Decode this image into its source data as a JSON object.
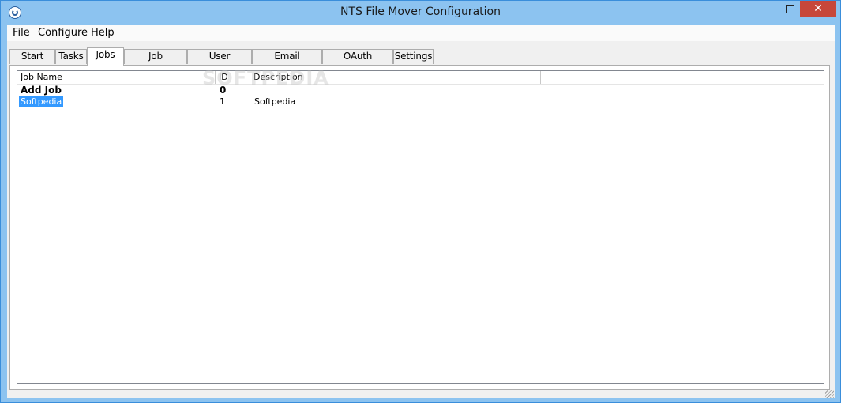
{
  "window": {
    "title": "NTS File Mover Configuration",
    "minimize_label": "–",
    "close_label": "✕"
  },
  "menu": [
    "File",
    "Configure",
    "Help"
  ],
  "tabs": [
    {
      "label": "Start Here",
      "active": false
    },
    {
      "label": "Tasks",
      "active": false
    },
    {
      "label": "Jobs",
      "active": true
    },
    {
      "label": "Job Schedules",
      "active": false
    },
    {
      "label": "User Accounts",
      "active": false
    },
    {
      "label": "Email Addresses",
      "active": false
    },
    {
      "label": "OAuth Accounts",
      "active": false
    },
    {
      "label": "Settings",
      "active": false
    }
  ],
  "jobs": {
    "columns": [
      "Job Name",
      "ID",
      "Description"
    ],
    "rows": [
      {
        "name": "Add Job",
        "id": "0",
        "description": "",
        "bold": true,
        "selected": false
      },
      {
        "name": "Softpedia",
        "id": "1",
        "description": "Softpedia",
        "bold": false,
        "selected": true
      }
    ]
  },
  "watermark": "SOFTPEDIA",
  "colors": {
    "titlebar": "#8cc3f0",
    "close_button": "#c7473a",
    "selection": "#3399ff"
  },
  "icons": {
    "app": "app-icon",
    "maximize": "maximize-icon",
    "resize_grip": "resize-grip-icon"
  }
}
